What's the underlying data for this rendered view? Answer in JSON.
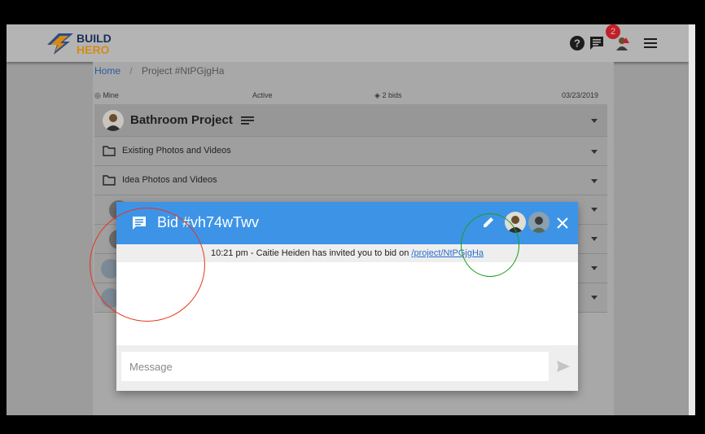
{
  "app": {
    "logo_line1": "BUILD",
    "logo_line2": "HERO",
    "notification_count": "2",
    "icons": [
      "help-icon",
      "chat-icon",
      "avatar-icon",
      "menu-icon"
    ]
  },
  "breadcrumb": {
    "home": "Home",
    "separator": "/",
    "current": "Project #NtPGjgHa"
  },
  "project_meta": {
    "owner": "Mine",
    "status": "Active",
    "bids": "2 bids",
    "date": "03/23/2019"
  },
  "project": {
    "title": "Bathroom Project"
  },
  "folders": [
    {
      "label": "Existing Photos and Videos"
    },
    {
      "label": "Idea Photos and Videos"
    }
  ],
  "dialog": {
    "title": "Bid #vh74wTwv",
    "system_message_prefix": "10:21 pm - Caitie Heiden has invited you to bid on ",
    "system_message_link": "/project/NtPGjgHa",
    "message_placeholder": "Message"
  },
  "colors": {
    "dialog_header": "#3d94e6",
    "badge": "#c0202a",
    "annotation_red": "#e8341c",
    "annotation_green": "#17a01a"
  }
}
